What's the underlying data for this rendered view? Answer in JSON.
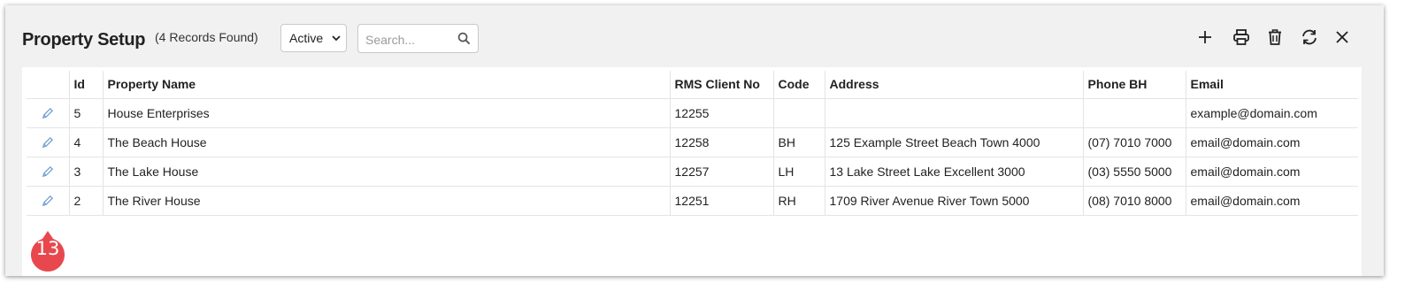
{
  "header": {
    "title": "Property Setup",
    "records_found": "(4 Records Found)",
    "status_filter": {
      "selected": "Active"
    },
    "search": {
      "placeholder": "Search...",
      "value": ""
    }
  },
  "toolbar": {
    "icons": [
      "plus-icon",
      "print-icon",
      "trash-icon",
      "refresh-icon",
      "close-icon"
    ]
  },
  "table": {
    "columns": [
      "",
      "Id",
      "Property Name",
      "RMS Client No",
      "Code",
      "Address",
      "Phone BH",
      "Email"
    ],
    "rows": [
      {
        "id": "5",
        "name": "House Enterprises",
        "rms_client_no": "12255",
        "code": "",
        "address": "",
        "phone": "",
        "email": "example@domain.com"
      },
      {
        "id": "4",
        "name": "The Beach House",
        "rms_client_no": "12258",
        "code": "BH",
        "address": "125 Example Street Beach Town 4000",
        "phone": "(07) 7010 7000",
        "email": "email@domain.com"
      },
      {
        "id": "3",
        "name": "The Lake House",
        "rms_client_no": "12257",
        "code": "LH",
        "address": "13 Lake Street Lake Excellent 3000",
        "phone": "(03) 5550 5000",
        "email": "email@domain.com"
      },
      {
        "id": "2",
        "name": "The River House",
        "rms_client_no": "12251",
        "code": "RH",
        "address": "1709 River Avenue River Town 5000",
        "phone": "(08) 7010 8000",
        "email": "email@domain.com"
      }
    ]
  },
  "callout": {
    "number": "13"
  },
  "colors": {
    "accent": "#2c7be5",
    "callout": "#e8484d",
    "edit_icon": "#6b9bd2"
  }
}
